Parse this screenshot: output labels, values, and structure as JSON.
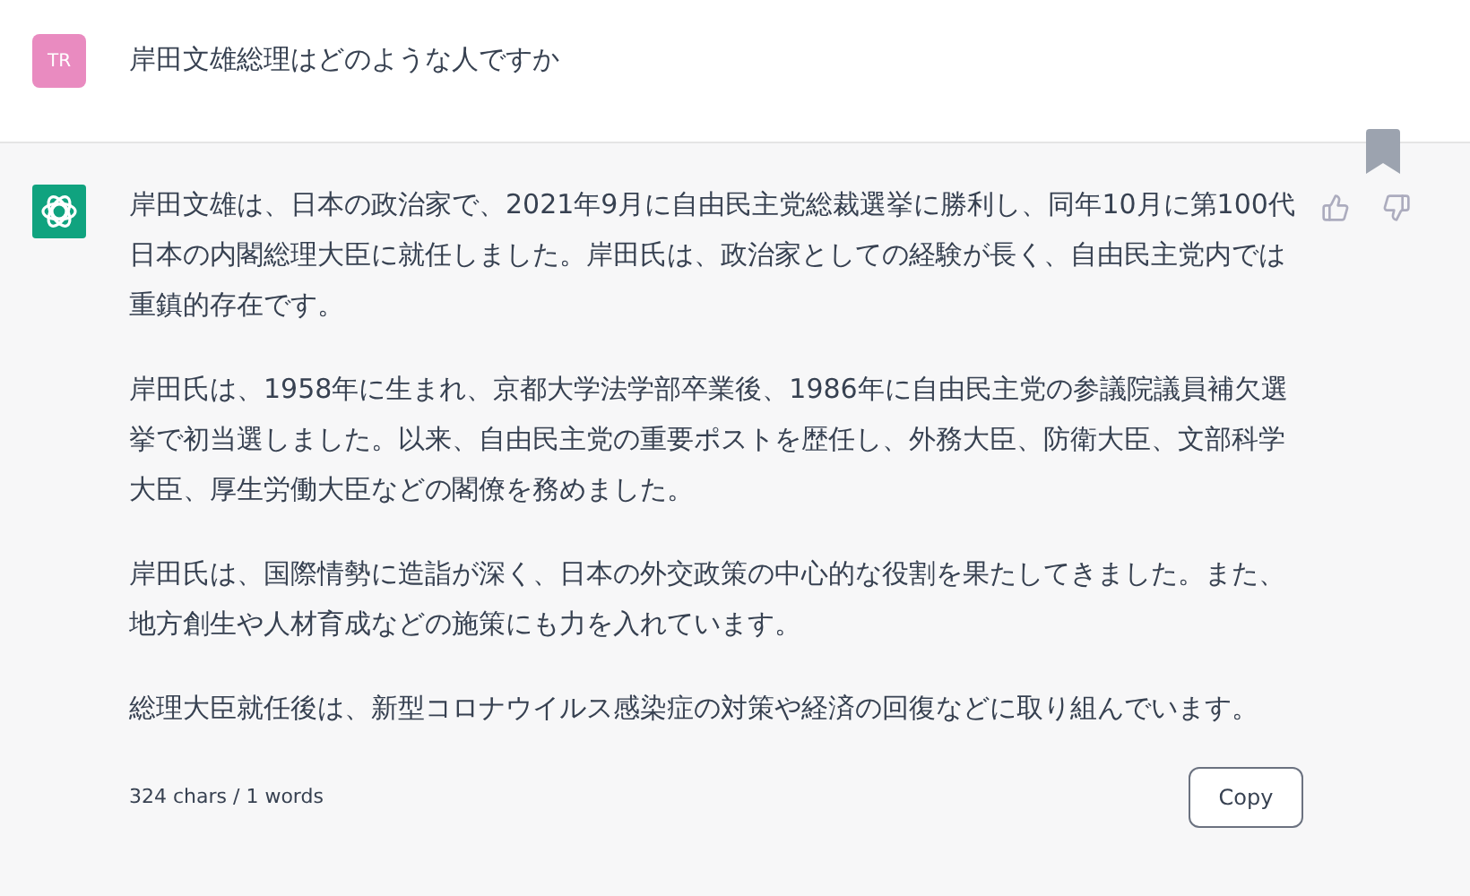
{
  "user_message": {
    "avatar": "TR",
    "text": "岸田文雄総理はどのような人ですか"
  },
  "assistant_message": {
    "paragraphs": [
      "岸田文雄は、日本の政治家で、2021年9月に自由民主党総裁選挙に勝利し、同年10月に第100代日本の内閣総理大臣に就任しました。岸田氏は、政治家としての経験が長く、自由民主党内では重鎮的存在です。",
      "岸田氏は、1958年に生まれ、京都大学法学部卒業後、1986年に自由民主党の参議院議員補欠選挙で初当選しました。以来、自由民主党の重要ポストを歴任し、外務大臣、防衛大臣、文部科学大臣、厚生労働大臣などの閣僚を務めました。",
      "岸田氏は、国際情勢に造詣が深く、日本の外交政策の中心的な役割を果たしてきました。また、地方創生や人材育成などの施策にも力を入れています。",
      "総理大臣就任後は、新型コロナウイルス感染症の対策や経済の回復などに取り組んでいます。"
    ],
    "counter": "324 chars / 1 words",
    "copy_button": "Copy"
  }
}
